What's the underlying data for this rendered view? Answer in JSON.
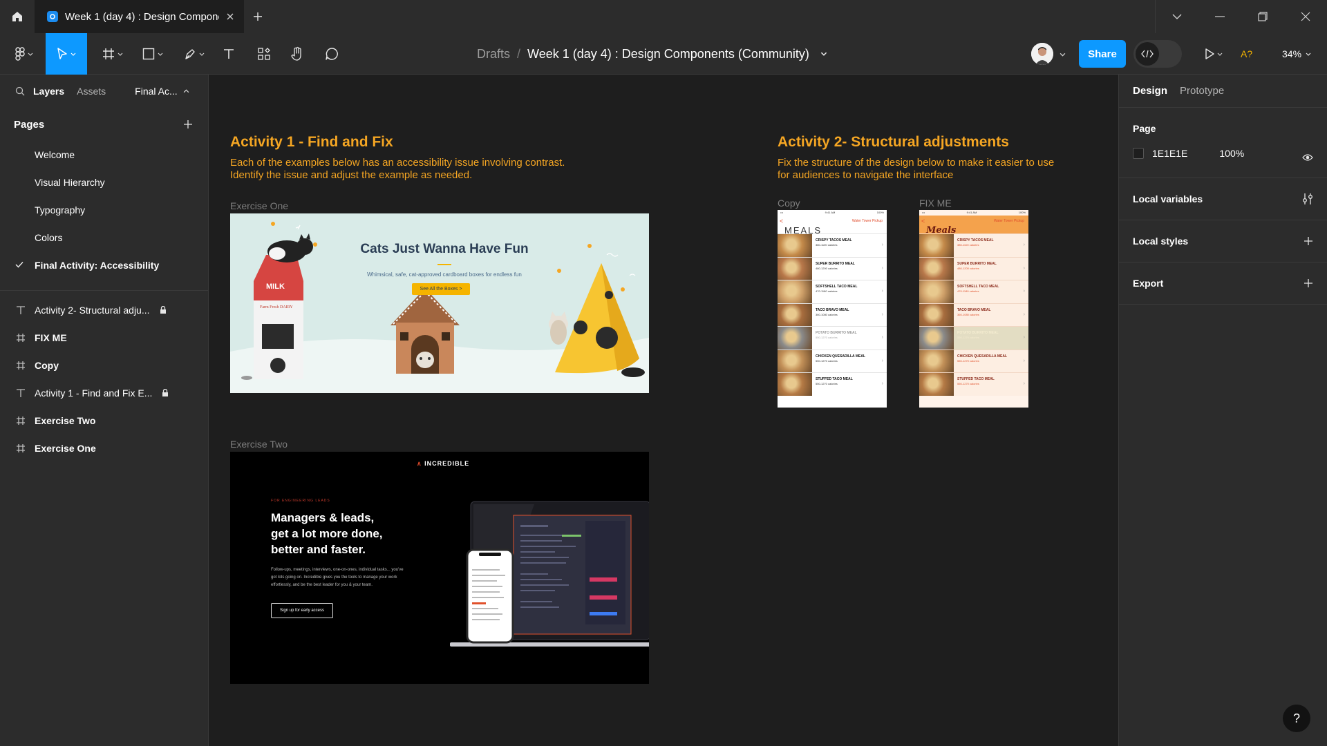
{
  "window": {
    "tab_title": "Week 1 (day 4) : Design Componer",
    "controls": [
      "minimize",
      "restore",
      "close"
    ]
  },
  "toolbar": {
    "breadcrumb_root": "Drafts",
    "breadcrumb_sep": "/",
    "file_name": "Week 1 (day 4) : Design Components (Community)",
    "share_label": "Share",
    "a_label": "A?",
    "zoom": "34%"
  },
  "left_panel": {
    "tabs": {
      "layers": "Layers",
      "assets": "Assets",
      "page_selector": "Final Ac..."
    },
    "pages_heading": "Pages",
    "pages": [
      {
        "label": "Welcome",
        "current": false
      },
      {
        "label": "Visual Hierarchy",
        "current": false
      },
      {
        "label": "Typography",
        "current": false
      },
      {
        "label": "Colors",
        "current": false
      },
      {
        "label": "Final Activity: Accessibility",
        "current": true
      }
    ],
    "layers": [
      {
        "label": "Activity 2- Structural adju...",
        "type": "text",
        "locked": true
      },
      {
        "label": "FIX ME",
        "type": "frame",
        "locked": false
      },
      {
        "label": "Copy",
        "type": "frame",
        "locked": false
      },
      {
        "label": "Activity 1 - Find and Fix E...",
        "type": "text",
        "locked": true
      },
      {
        "label": "Exercise Two",
        "type": "frame",
        "locked": false
      },
      {
        "label": "Exercise One",
        "type": "frame",
        "locked": false
      }
    ]
  },
  "right_panel": {
    "tabs": {
      "design": "Design",
      "prototype": "Prototype"
    },
    "page_section": "Page",
    "page_color": "1E1E1E",
    "page_opacity": "100%",
    "local_variables": "Local variables",
    "local_styles": "Local styles",
    "export": "Export",
    "help": "?"
  },
  "canvas": {
    "activity1": {
      "title": "Activity 1 - Find and Fix",
      "desc_line1": "Each of the examples below has an accessibility issue involving contrast.",
      "desc_line2": "Identify the issue and adjust the example as needed."
    },
    "activity2": {
      "title": "Activity 2- Structural adjustments",
      "desc_line1": "Fix the structure of the design below to make it easier to use",
      "desc_line2": "for audiences to navigate the interface"
    },
    "exercise_one": {
      "label": "Exercise One",
      "headline": "Cats Just Wanna Have Fun",
      "tagline": "Whimsical, safe, cat-approved cardboard boxes for endless fun",
      "cta": "See All the Boxes >",
      "carton_top": "MILK",
      "carton_brand": "Farm Fresh DAIRY"
    },
    "exercise_two": {
      "label": "Exercise Two",
      "brand": "INCREDIBLE",
      "eyebrow": "FOR ENGINEERING LEADS",
      "hero_line1": "Managers & leads,",
      "hero_line2": "get a lot more done,",
      "hero_line3": "better and faster.",
      "paragraph": "Follow-ups, meetings, interviews, one-on-ones, individual tasks... you've got lots going on. Incredible gives you the tools to manage your work effortlessly, and be the best leader for you & your team.",
      "cta": "Sign up for early access"
    },
    "copy_phone": {
      "label": "Copy",
      "title": "MEALS",
      "location": "Water Tower Pickup",
      "time": "9:41 AM",
      "battery": "100%"
    },
    "fix_phone": {
      "label": "FIX ME",
      "title": "Meals",
      "location": "Water Tower Pickup",
      "time": "9:41 AM",
      "battery": "100%"
    },
    "meals": [
      {
        "name": "CRISPY TACOS MEAL",
        "cal": "380-1100 calories"
      },
      {
        "name": "SUPER BURRITO MEAL",
        "cal": "480-1200 calories"
      },
      {
        "name": "SOFTSHELL TACO MEAL",
        "cal": "470-1180 calories"
      },
      {
        "name": "TACO BRAVO MEAL",
        "cal": "360-1080 calories"
      },
      {
        "name": "POTATO BURRITO MEAL",
        "cal": "550-1270 calories"
      },
      {
        "name": "CHICKEN QUESADILLA MEAL",
        "cal": "550-1270 calories"
      },
      {
        "name": "STUFFED TACO MEAL",
        "cal": "550-1270 calories"
      }
    ]
  },
  "colors": {
    "accent": "#0d99ff",
    "activity_text": "#f5a623",
    "canvas_bg": "#1e1e1e"
  }
}
